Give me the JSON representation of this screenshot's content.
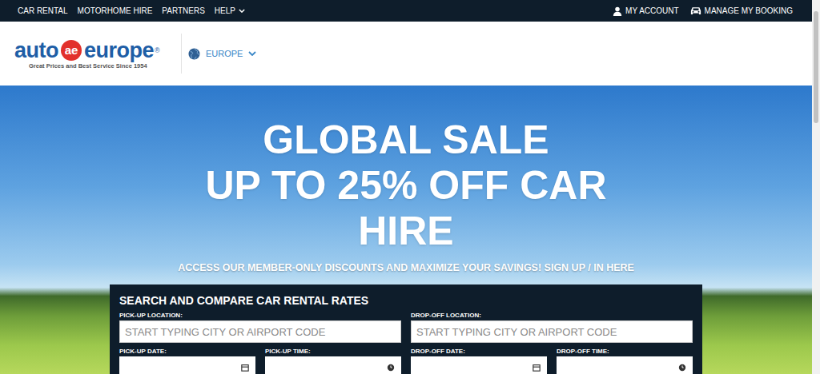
{
  "nav": {
    "links": [
      {
        "label": "CAR RENTAL",
        "dropdown": false
      },
      {
        "label": "MOTORHOME HIRE",
        "dropdown": false
      },
      {
        "label": "PARTNERS",
        "dropdown": false
      },
      {
        "label": "HELP",
        "dropdown": true
      }
    ],
    "account": "MY ACCOUNT",
    "booking": "MANAGE MY BOOKING"
  },
  "logo": {
    "left": "auto",
    "mark": "ae",
    "right": "europe",
    "reg": "®",
    "tagline": "Great Prices and Best Service Since 1954"
  },
  "region": {
    "label": "EUROPE"
  },
  "hero": {
    "lines": [
      "GLOBAL SALE",
      "UP TO 25% OFF CAR",
      "HIRE"
    ],
    "subtitle": "ACCESS OUR MEMBER-ONLY DISCOUNTS AND MAXIMIZE YOUR SAVINGS! SIGN UP / IN HERE"
  },
  "search": {
    "title": "SEARCH AND COMPARE CAR RENTAL RATES",
    "locations": [
      {
        "label": "PICK-UP LOCATION:",
        "placeholder": "START TYPING CITY OR AIRPORT CODE"
      },
      {
        "label": "DROP-OFF LOCATION:",
        "placeholder": "START TYPING CITY OR AIRPORT CODE"
      }
    ],
    "times": [
      {
        "label": "PICK-UP DATE:",
        "kind": "date"
      },
      {
        "label": "PICK-UP TIME:",
        "kind": "time"
      },
      {
        "label": "DROP-OFF DATE:",
        "kind": "date"
      },
      {
        "label": "DROP-OFF TIME:",
        "kind": "time"
      }
    ]
  }
}
